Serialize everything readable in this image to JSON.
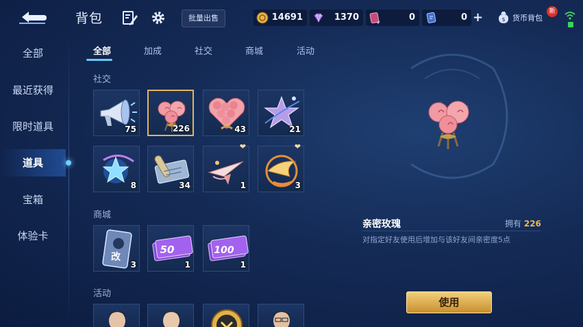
{
  "header": {
    "title": "背包",
    "batch_sell_label": "批量出售",
    "currencies": [
      {
        "icon": "gold-coin-icon",
        "value": "14691"
      },
      {
        "icon": "diamond-icon",
        "value": "1370"
      },
      {
        "icon": "red-ticket-icon",
        "value": "0"
      },
      {
        "icon": "blue-ticket-icon",
        "value": "0"
      }
    ],
    "wallet_label": "货币背包",
    "new_badge": "新"
  },
  "sidebar": {
    "items": [
      {
        "label": "全部"
      },
      {
        "label": "最近获得"
      },
      {
        "label": "限时道具"
      },
      {
        "label": "道具",
        "active": true
      },
      {
        "label": "宝箱"
      },
      {
        "label": "体验卡"
      }
    ]
  },
  "tabs": [
    {
      "label": "全部",
      "active": true
    },
    {
      "label": "加成"
    },
    {
      "label": "社交"
    },
    {
      "label": "商城"
    },
    {
      "label": "活动"
    }
  ],
  "sections": {
    "social": {
      "label": "社交",
      "items": [
        {
          "icon": "megaphone-icon",
          "qty": "75"
        },
        {
          "icon": "rose-bouquet-icon",
          "qty": "226",
          "selected": true
        },
        {
          "icon": "heart-roses-icon",
          "qty": "43"
        },
        {
          "icon": "star-gift-icon",
          "qty": "21"
        },
        {
          "icon": "blue-flame-icon",
          "qty": "8"
        },
        {
          "icon": "scroll-icon",
          "qty": "34"
        },
        {
          "icon": "paper-plane-icon",
          "qty": "1"
        },
        {
          "icon": "golden-bird-icon",
          "qty": "3"
        }
      ]
    },
    "mall": {
      "label": "商城",
      "items": [
        {
          "icon": "rename-card-icon",
          "qty": "3",
          "text": "改"
        },
        {
          "icon": "coupon-50-icon",
          "qty": "1",
          "text": "50"
        },
        {
          "icon": "coupon-100-icon",
          "qty": "1",
          "text": "100"
        }
      ]
    },
    "event": {
      "label": "活动"
    }
  },
  "detail": {
    "name": "亲密玫瑰",
    "owned_label": "拥有",
    "owned_count": "226",
    "description": "对指定好友使用后增加与该好友间亲密度5点",
    "use_label": "使用"
  }
}
